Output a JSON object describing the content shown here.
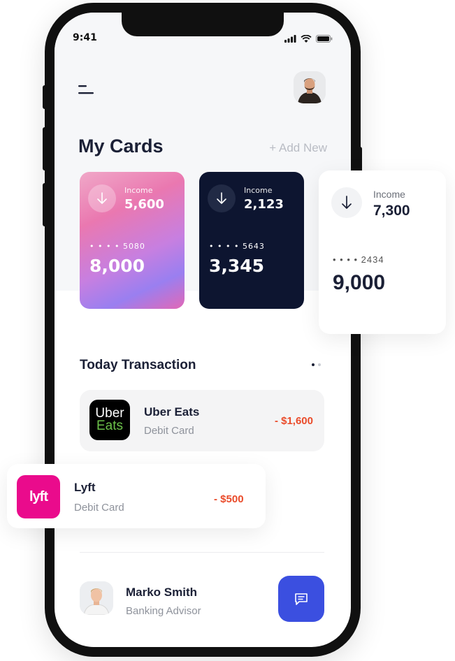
{
  "status": {
    "time": "9:41"
  },
  "header": {
    "title": "My Cards",
    "add_new": "+ Add New"
  },
  "cards": [
    {
      "income_label": "Income",
      "income_value": "5,600",
      "number": "• • • •  5080",
      "balance": "8,000",
      "style": "pink"
    },
    {
      "income_label": "Income",
      "income_value": "2,123",
      "number": "• • • •  5643",
      "balance": "3,345",
      "style": "dark"
    },
    {
      "income_label": "Income",
      "income_value": "7,300",
      "number": "• • • •  2434",
      "balance": "9,000",
      "style": "white"
    }
  ],
  "transactions": {
    "title": "Today Transaction",
    "items": [
      {
        "logo_line1": "Uber",
        "logo_line2": "Eats",
        "name": "Uber Eats",
        "method": "Debit Card",
        "amount": "- $1,600"
      },
      {
        "logo": "lyft",
        "name": "Lyft",
        "method": "Debit Card",
        "amount": "- $500"
      }
    ]
  },
  "advisor": {
    "name": "Marko Smith",
    "role": "Banking Advisor"
  },
  "icons": {
    "menu": "menu-icon",
    "arrow_down": "arrow-down-icon",
    "chat": "chat-icon",
    "signal": "signal-icon",
    "wifi": "wifi-icon",
    "battery": "battery-icon"
  },
  "colors": {
    "accent": "#3b4fe0",
    "expense": "#ea4b2a",
    "dark_card": "#0d1530",
    "lyft_brand": "#ea0b8c",
    "uber_green": "#6cc24a"
  }
}
